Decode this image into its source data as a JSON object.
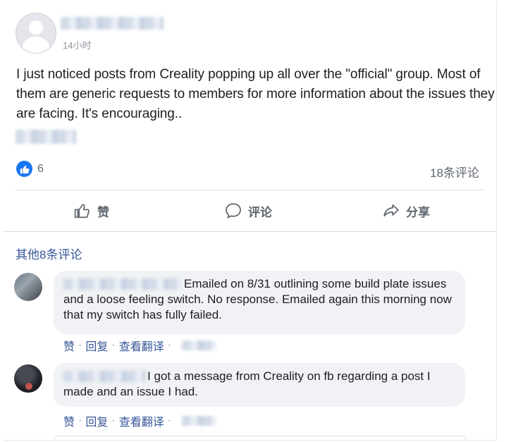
{
  "post": {
    "author_name": "",
    "timestamp": "14小时",
    "text": "I just noticed posts from Creality popping up all over the \"official\" group. Most of them are generic requests to members for more information about the issues they are facing. It's encouraging..",
    "likes": "6",
    "comment_count": "18条评论"
  },
  "actions": {
    "like_label": "赞",
    "comment_label": "评论",
    "share_label": "分享"
  },
  "comments_section": {
    "more_label": "其他8条评论",
    "comments": [
      {
        "text": "Emailed on 8/31 outlining some build plate issues and a loose feeling switch. No response. Emailed again this morning now that my switch has fully failed.",
        "like_label": "赞",
        "reply_label": "回复",
        "translate_label": "查看翻译"
      },
      {
        "text": "I got a message from Creality on fb regarding a post I made and an issue I had.",
        "like_label": "赞",
        "reply_label": "回复",
        "translate_label": "查看翻译"
      }
    ]
  },
  "colors": {
    "link": "#385898",
    "like_blue": "#1877f2",
    "bubble_bg": "#f0f2f5"
  },
  "icons": [
    "thumbs-up-icon",
    "comment-icon",
    "share-icon",
    "like-reaction-icon"
  ]
}
